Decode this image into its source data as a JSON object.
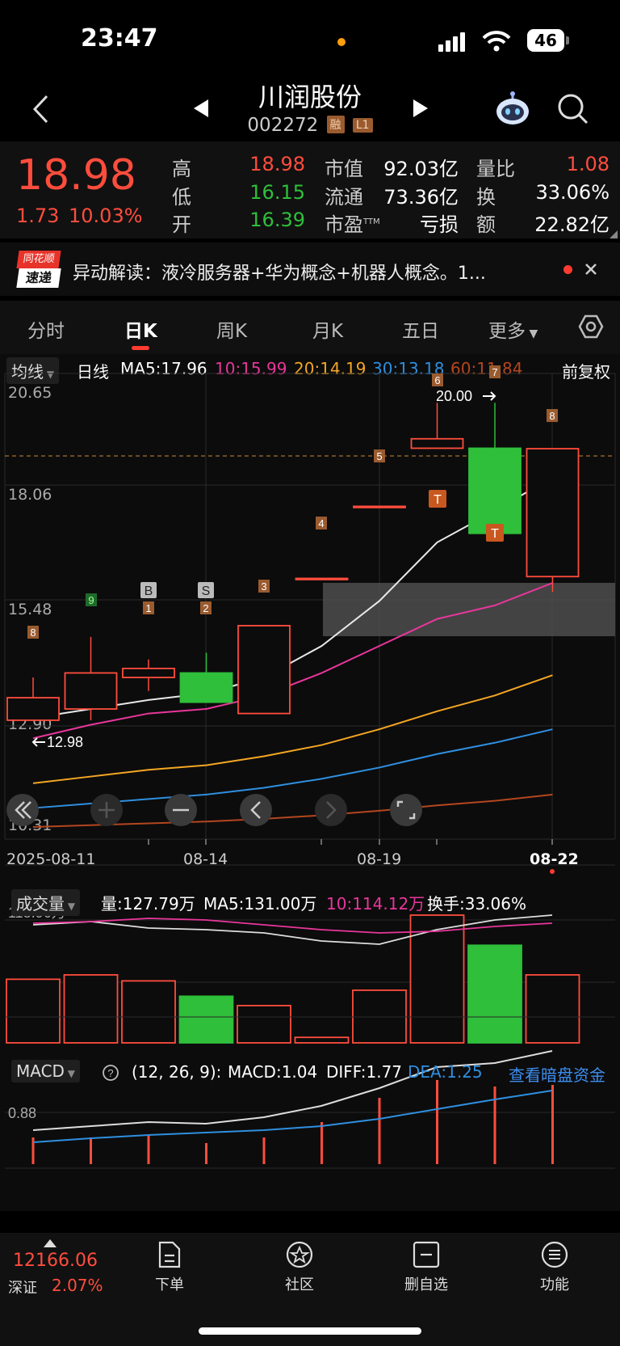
{
  "status": {
    "time": "23:47",
    "battery": "46"
  },
  "header": {
    "name": "川润股份",
    "code": "002272",
    "tags": [
      "融",
      "L1"
    ]
  },
  "quote": {
    "price": "18.98",
    "change": "1.73",
    "change_pct": "10.03%",
    "high_label": "高",
    "high": "18.98",
    "low_label": "低",
    "low": "16.15",
    "open_label": "开",
    "open": "16.39",
    "mcap_label": "市值",
    "mcap": "92.03亿",
    "float_label": "流通",
    "float": "73.36亿",
    "pe_label": "市盈",
    "pe_sup": "TTM",
    "pe": "亏损",
    "volratio_label": "量比",
    "volratio": "1.08",
    "turnover_label": "换",
    "turnover": "33.06%",
    "amount_label": "额",
    "amount": "22.82亿"
  },
  "news": {
    "logo_top": "同花顺",
    "logo_bottom": "速递",
    "text": "异动解读：液冷服务器+华为概念+机器人概念。1..."
  },
  "tabs": [
    "分时",
    "日K",
    "周K",
    "月K",
    "五日",
    "更多"
  ],
  "active_tab": 1,
  "kline": {
    "ma_selector": "均线",
    "period": "日线",
    "ma5": "MA5:17.96",
    "ma10": "10:15.99",
    "ma20": "20:14.19",
    "ma30": "30:13.18",
    "ma60": "60:11.84",
    "adjust": "前复权",
    "y_labels": [
      "20.65",
      "18.06",
      "15.48",
      "12.90",
      "10.31"
    ],
    "annot_high": "20.00",
    "annot_low": "12.98",
    "dates": [
      "2025-08-11",
      "08-14",
      "08-19",
      "08-22"
    ],
    "markers": [
      "8",
      "9",
      "1",
      "2",
      "3",
      "4",
      "5",
      "6",
      "7",
      "8"
    ],
    "badge_b": "B",
    "badge_s": "S",
    "badge_t": "T"
  },
  "chart_data": {
    "type": "candlestick",
    "candles": [
      {
        "open": 12.95,
        "close": 13.45,
        "high": 13.9,
        "low": 12.95,
        "up": true
      },
      {
        "open": 13.2,
        "close": 14.0,
        "high": 14.8,
        "low": 12.95,
        "up": true
      },
      {
        "open": 13.9,
        "close": 14.1,
        "high": 14.3,
        "low": 13.6,
        "up": true
      },
      {
        "open": 14.0,
        "close": 13.35,
        "high": 14.45,
        "low": 13.35,
        "up": false
      },
      {
        "open": 13.1,
        "close": 15.05,
        "high": 15.05,
        "low": 13.1,
        "up": true
      },
      {
        "open": 16.1,
        "close": 16.1,
        "high": 16.1,
        "low": 16.1,
        "up": true
      },
      {
        "open": 17.7,
        "close": 17.7,
        "high": 17.7,
        "low": 17.7,
        "up": true
      },
      {
        "open": 18.99,
        "close": 19.2,
        "high": 20.0,
        "low": 18.99,
        "up": true
      },
      {
        "open": 18.99,
        "close": 17.1,
        "high": 20.0,
        "low": 17.1,
        "up": false
      },
      {
        "open": 16.14,
        "close": 18.98,
        "high": 18.98,
        "low": 15.8,
        "up": true
      }
    ],
    "ylim": [
      10.31,
      20.65
    ],
    "volume": {
      "values": [
        116,
        124,
        113,
        85,
        68,
        10,
        96,
        233,
        178,
        124
      ],
      "up": [
        true,
        true,
        true,
        false,
        true,
        true,
        true,
        true,
        false,
        true
      ],
      "ref_label": "118.96万",
      "vol_text": "量:127.79万",
      "ma5_text": "MA5:131.00万",
      "ma10_text": "10:114.12万",
      "turnover_text": "换手:33.06%",
      "selector": "成交量"
    },
    "macd": {
      "selector": "MACD",
      "params": "(12, 26, 9):",
      "macd_text": "MACD:1.04",
      "diff_text": "DIFF:1.77",
      "dea_text": "DEA:1.25",
      "link": "查看暗盘资金",
      "ref_label": "0.88"
    }
  },
  "bottom": {
    "index_value": "12166.06",
    "index_name": "深证",
    "index_pct": "2.07%",
    "items": [
      "下单",
      "社区",
      "删自选",
      "功能"
    ]
  },
  "colors": {
    "up": "#ff4d3d",
    "down": "#2fbf3a",
    "ma10": "#e8369b",
    "ma20": "#f5a623",
    "ma30": "#2f8fe0",
    "ma60": "#b4461f"
  }
}
